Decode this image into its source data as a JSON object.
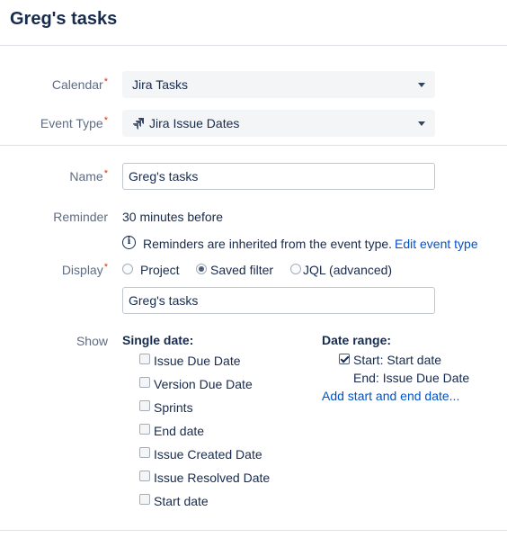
{
  "header": {
    "title": "Greg's tasks"
  },
  "form": {
    "calendar": {
      "label": "Calendar",
      "required": "*",
      "value": "Jira Tasks"
    },
    "event_type": {
      "label": "Event Type",
      "required": "*",
      "value": "Jira Issue Dates",
      "icon": "jira-icon"
    },
    "name": {
      "label": "Name",
      "required": "*",
      "value": "Greg's tasks"
    },
    "reminder": {
      "label": "Reminder",
      "value": "30 minutes before",
      "info_text": "Reminders are inherited from the event type.",
      "info_link": "Edit event type"
    },
    "display": {
      "label": "Display",
      "required": "*",
      "options": [
        {
          "label": "Project",
          "selected": false
        },
        {
          "label": "Saved filter",
          "selected": true
        },
        {
          "label": "JQL (advanced)",
          "selected": false
        }
      ],
      "filter_value": "Greg's tasks"
    },
    "show": {
      "label": "Show",
      "single_date": {
        "heading": "Single date:",
        "items": [
          {
            "label": "Issue Due Date",
            "checked": false
          },
          {
            "label": "Version Due Date",
            "checked": false
          },
          {
            "label": "Sprints",
            "checked": false
          },
          {
            "label": "End date",
            "checked": false
          },
          {
            "label": "Issue Created Date",
            "checked": false
          },
          {
            "label": "Issue Resolved Date",
            "checked": false
          },
          {
            "label": "Start date",
            "checked": false
          }
        ]
      },
      "date_range": {
        "heading": "Date range:",
        "start": {
          "label": "Start: Start date",
          "checked": true
        },
        "end": "End: Issue Due Date",
        "add_link": "Add start and end date..."
      }
    }
  },
  "colors": {
    "text": "#172b4d",
    "label": "#5e6c84",
    "link": "#0052cc",
    "required": "#de350b",
    "select_bg": "#f4f5f7",
    "border": "#dfe1e6"
  }
}
